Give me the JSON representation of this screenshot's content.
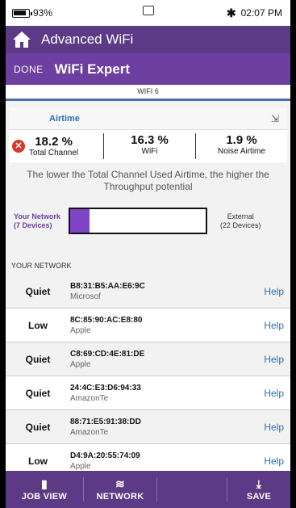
{
  "status": {
    "battery": "93%",
    "time": "02:07 PM"
  },
  "app": {
    "title": "Advanced WiFi"
  },
  "subbar": {
    "done": "DONE",
    "title": "WiFi Expert"
  },
  "strip": {
    "label": "WIFI 6"
  },
  "airtime": {
    "title": "Airtime",
    "total_pct": "18.2 %",
    "total_label": "Total Channel",
    "wifi_pct": "16.3 %",
    "wifi_label": "WiFi",
    "noise_pct": "1.9 %",
    "noise_label": "Noise Airtime",
    "hint": "The lower the Total Channel Used Airtime, the higher the Throughput potential",
    "your_network": "Your Network",
    "your_devices": "(7 Devices)",
    "external": "External",
    "external_devices": "(22 Devices)",
    "your_share_fraction": 0.14
  },
  "network": {
    "section_label": "YOUR NETWORK",
    "rows": [
      {
        "level": "Quiet",
        "mac": "B8:31:B5:AA:E6:9C",
        "vendor": "Microsof",
        "help": "Help"
      },
      {
        "level": "Low",
        "mac": "8C:85:90:AC:E8:80",
        "vendor": "Apple",
        "help": "Help"
      },
      {
        "level": "Quiet",
        "mac": "C8:69:CD:4E:81:DE",
        "vendor": "Apple",
        "help": "Help"
      },
      {
        "level": "Quiet",
        "mac": "24:4C:E3:D6:94:33",
        "vendor": "AmazonTe",
        "help": "Help"
      },
      {
        "level": "Quiet",
        "mac": "88:71:E5:91:38:DD",
        "vendor": "AmazonTe",
        "help": "Help"
      },
      {
        "level": "Low",
        "mac": "D4:9A:20:55:74:09",
        "vendor": "Apple",
        "help": "Help"
      }
    ]
  },
  "bottom": {
    "job_view": "JOB VIEW",
    "network": "NETWORK",
    "save": "SAVE"
  },
  "colors": {
    "accent": "#5c3a85",
    "link": "#2a6fb5",
    "error": "#d9372b",
    "fill": "#7f45c7"
  }
}
